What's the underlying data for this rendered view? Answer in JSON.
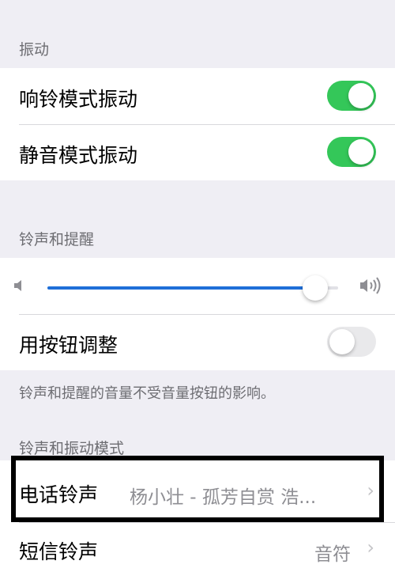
{
  "vibration": {
    "header": "振动",
    "ring_vibrate_label": "响铃模式振动",
    "ring_vibrate_on": true,
    "silent_vibrate_label": "静音模式振动",
    "silent_vibrate_on": true
  },
  "ringer": {
    "header": "铃声和提醒",
    "volume_level": 0.92,
    "adjust_with_buttons_label": "用按钮调整",
    "adjust_with_buttons_on": false,
    "note": "铃声和提醒的音量不受音量按钮的影响。"
  },
  "patterns": {
    "header": "铃声和振动模式",
    "ringtone_label": "电话铃声",
    "ringtone_value": "杨小壮 - 孤芳自赏 浩...",
    "text_tone_label": "短信铃声",
    "text_tone_value": "音符"
  },
  "colors": {
    "toggle_on": "#34c759",
    "slider_fill": "#1f6fd8",
    "highlight_border": "#000000"
  },
  "icons": [
    "speaker-low-icon",
    "speaker-high-icon",
    "chevron-right-icon"
  ]
}
